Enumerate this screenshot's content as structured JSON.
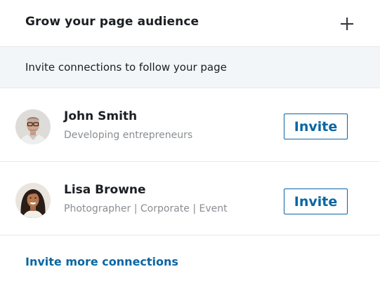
{
  "header": {
    "title": "Grow your page audience",
    "add_icon": "plus-icon"
  },
  "subheader": {
    "text": "Invite connections to follow your page"
  },
  "people": [
    {
      "name": "John Smith",
      "headline": "Developing entrepreneurs",
      "invite_label": "Invite",
      "avatar": "man-with-glasses-photo"
    },
    {
      "name": "Lisa Browne",
      "headline": "Photographer | Corporate | Event",
      "invite_label": "Invite",
      "avatar": "smiling-woman-photo"
    }
  ],
  "footer": {
    "link_label": "Invite more connections"
  },
  "colors": {
    "accent": "#0a66a2",
    "secondary_text": "#8a8e92",
    "subheader_bg": "#f3f6f8",
    "divider": "#e6e9ec"
  }
}
